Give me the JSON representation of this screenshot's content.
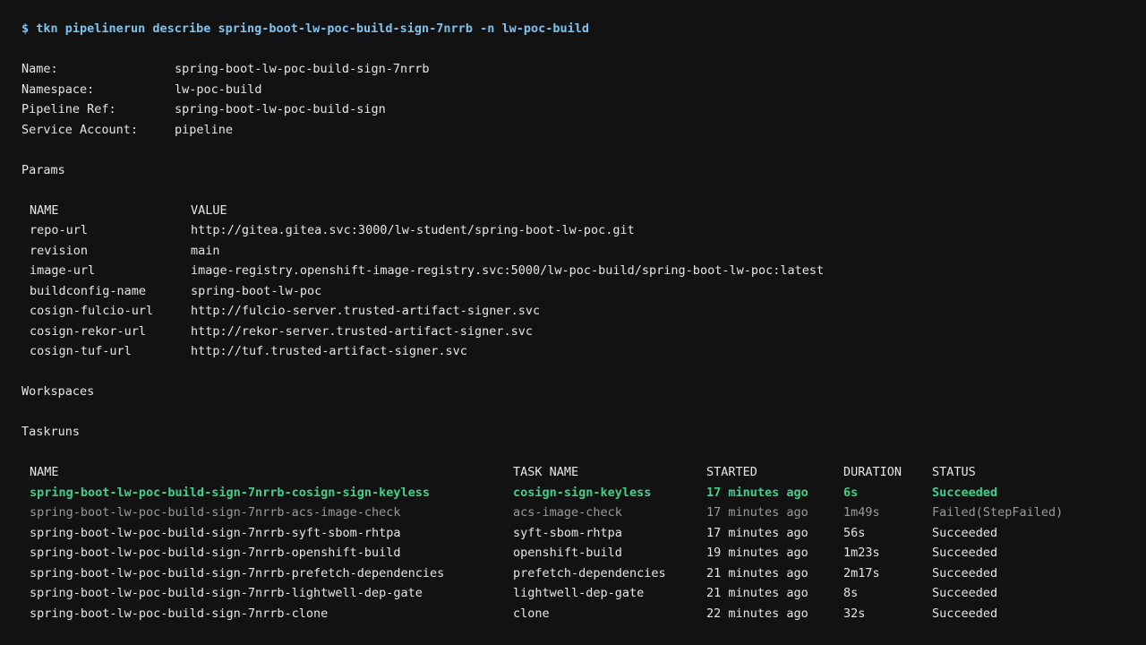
{
  "command": {
    "prompt": "$",
    "text": "tkn pipelinerun describe spring-boot-lw-poc-build-sign-7nrrb -n lw-poc-build"
  },
  "info": [
    {
      "key": "Name:",
      "value": "spring-boot-lw-poc-build-sign-7nrrb"
    },
    {
      "key": "Namespace:",
      "value": "lw-poc-build"
    },
    {
      "key": "Pipeline Ref:",
      "value": "spring-boot-lw-poc-build-sign"
    },
    {
      "key": "Service Account:",
      "value": "pipeline"
    }
  ],
  "params": {
    "section_title": "Params",
    "headers": {
      "name": "NAME",
      "value": "VALUE"
    },
    "rows": [
      {
        "name": "repo-url",
        "value": "http://gitea.gitea.svc:3000/lw-student/spring-boot-lw-poc.git"
      },
      {
        "name": "revision",
        "value": "main"
      },
      {
        "name": "image-url",
        "value": "image-registry.openshift-image-registry.svc:5000/lw-poc-build/spring-boot-lw-poc:latest"
      },
      {
        "name": "buildconfig-name",
        "value": "spring-boot-lw-poc"
      },
      {
        "name": "cosign-fulcio-url",
        "value": "http://fulcio-server.trusted-artifact-signer.svc"
      },
      {
        "name": "cosign-rekor-url",
        "value": "http://rekor-server.trusted-artifact-signer.svc"
      },
      {
        "name": "cosign-tuf-url",
        "value": "http://tuf.trusted-artifact-signer.svc"
      }
    ]
  },
  "workspaces": {
    "section_title": "Workspaces"
  },
  "taskruns": {
    "section_title": "Taskruns",
    "headers": {
      "name": "NAME",
      "task": "TASK NAME",
      "started": "STARTED",
      "duration": "DURATION",
      "status": "STATUS"
    },
    "rows": [
      {
        "name": "spring-boot-lw-poc-build-sign-7nrrb-cosign-sign-keyless",
        "task": "cosign-sign-keyless",
        "started": "17 minutes ago",
        "duration": "6s",
        "status": "Succeeded",
        "style": "ok"
      },
      {
        "name": "spring-boot-lw-poc-build-sign-7nrrb-acs-image-check",
        "task": "acs-image-check",
        "started": "17 minutes ago",
        "duration": "1m49s",
        "status": "Failed(StepFailed)",
        "style": "muted"
      },
      {
        "name": "spring-boot-lw-poc-build-sign-7nrrb-syft-sbom-rhtpa",
        "task": "syft-sbom-rhtpa",
        "started": "17 minutes ago",
        "duration": "56s",
        "status": "Succeeded",
        "style": "normal"
      },
      {
        "name": "spring-boot-lw-poc-build-sign-7nrrb-openshift-build",
        "task": "openshift-build",
        "started": "19 minutes ago",
        "duration": "1m23s",
        "status": "Succeeded",
        "style": "normal"
      },
      {
        "name": "spring-boot-lw-poc-build-sign-7nrrb-prefetch-dependencies",
        "task": "prefetch-dependencies",
        "started": "21 minutes ago",
        "duration": "2m17s",
        "status": "Succeeded",
        "style": "normal"
      },
      {
        "name": "spring-boot-lw-poc-build-sign-7nrrb-lightwell-dep-gate",
        "task": "lightwell-dep-gate",
        "started": "21 minutes ago",
        "duration": "8s",
        "status": "Succeeded",
        "style": "normal"
      },
      {
        "name": "spring-boot-lw-poc-build-sign-7nrrb-clone",
        "task": "clone",
        "started": "22 minutes ago",
        "duration": "32s",
        "status": "Succeeded",
        "style": "normal"
      }
    ]
  },
  "colors": {
    "background": "#121212",
    "text": "#e6e6e6",
    "command": "#7ec3f0",
    "success_highlight": "#3fd18a",
    "muted": "#9a9a9a"
  }
}
